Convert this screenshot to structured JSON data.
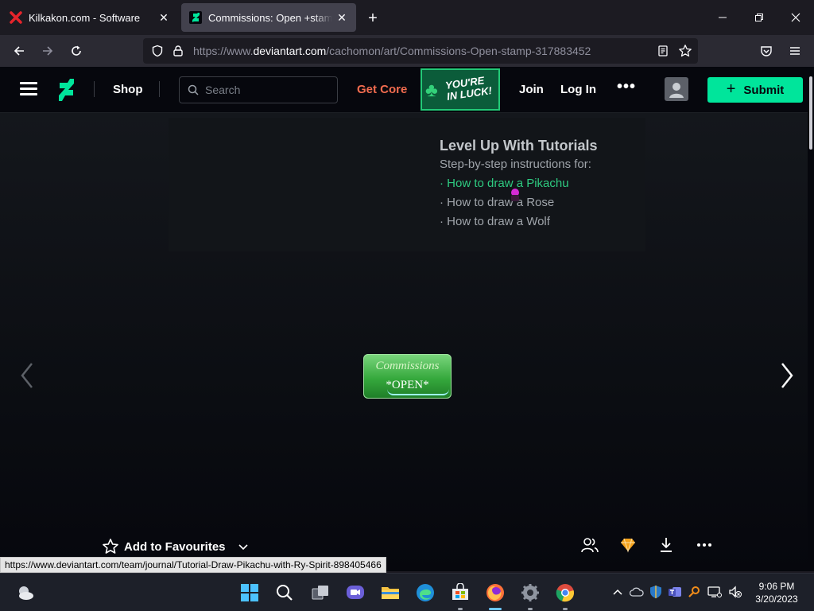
{
  "browser": {
    "tabs": [
      {
        "title": "Kilkakon.com - Software",
        "icon": "kilkakon-x-icon"
      },
      {
        "title": "Commissions: Open +stamp+ by",
        "icon": "deviantart-icon"
      }
    ],
    "url": {
      "prefix": "https://www.",
      "domain": "deviantart.com",
      "path": "/cachomon/art/Commissions-Open-stamp-317883452"
    }
  },
  "header": {
    "shop": "Shop",
    "search_placeholder": "Search",
    "get_core": "Get Core",
    "promo_badge": [
      "YOU'RE",
      "IN LUCK!"
    ],
    "join": "Join",
    "login": "Log In",
    "more": "•••",
    "submit": "Submit"
  },
  "promo": {
    "title": "Level Up With Tutorials",
    "subtitle": "Step-by-step instructions for:",
    "links": [
      "· How to draw a Pikachu",
      "· How to draw a Rose",
      "· How to draw a Wolf"
    ]
  },
  "stamp": {
    "line1": "Commissions",
    "line2": "*OPEN*"
  },
  "actions": {
    "favourite": "Add to Favourites"
  },
  "status_url": "https://www.deviantart.com/team/journal/Tutorial-Draw-Pikachu-with-Ry-Spirit-898405466",
  "taskbar": {
    "apps": [
      "windows-start",
      "search",
      "task-view",
      "chat",
      "file-explorer",
      "edge",
      "store",
      "firefox",
      "settings",
      "chrome"
    ],
    "clock_time": "9:06 PM",
    "clock_date": "3/20/2023"
  },
  "colors": {
    "accent_green": "#00e59b",
    "get_core": "#f26c4f",
    "link_active": "#2ecb81"
  }
}
